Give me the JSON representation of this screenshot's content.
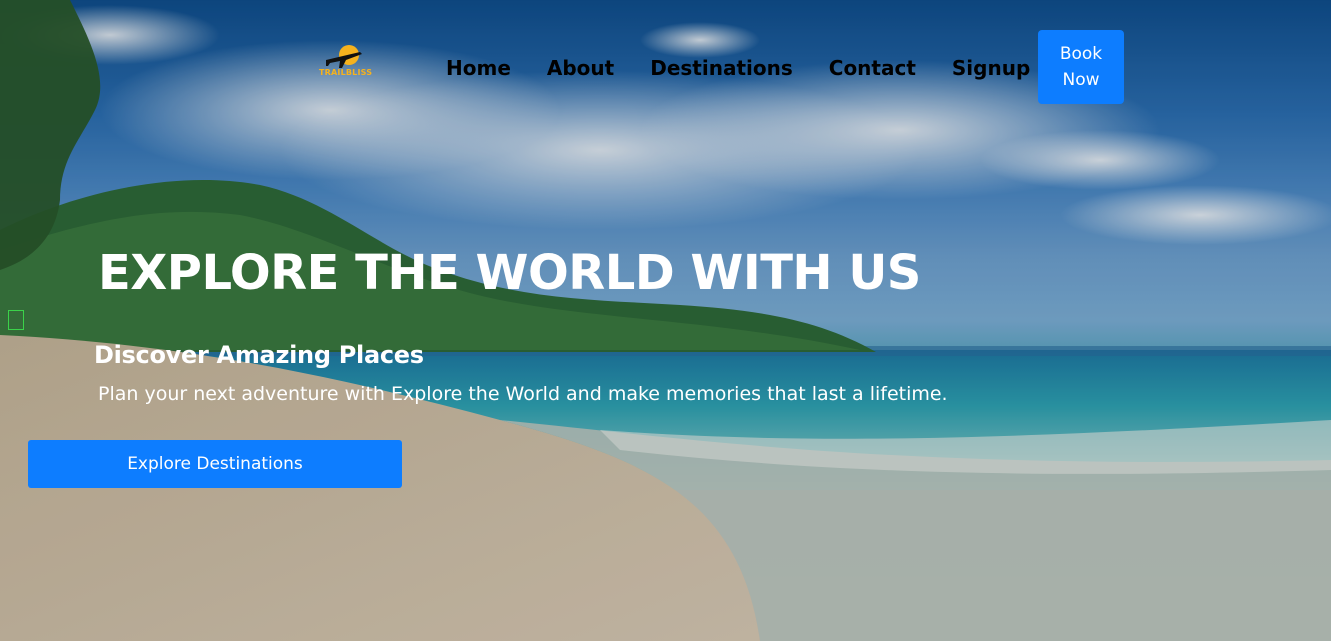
{
  "logo": {
    "text": "TRAILBLISS",
    "icon": "airplane-sun-icon",
    "color": "#f5b21e"
  },
  "nav": {
    "items": [
      {
        "label": "Home"
      },
      {
        "label": "About"
      },
      {
        "label": "Destinations"
      },
      {
        "label": "Contact"
      },
      {
        "label": "Signup"
      }
    ],
    "book_button": "Book Now"
  },
  "hero": {
    "title": "EXPLORE THE WORLD WITH US",
    "subtitle": "Discover Amazing Places",
    "description": "Plan your next adventure with Explore the World and make memories that last a lifetime.",
    "cta_label": "Explore Destinations",
    "background": "beach-landscape-image"
  },
  "colors": {
    "accent": "#0d7dff",
    "nav_text": "#000000",
    "hero_text": "#ffffff"
  }
}
